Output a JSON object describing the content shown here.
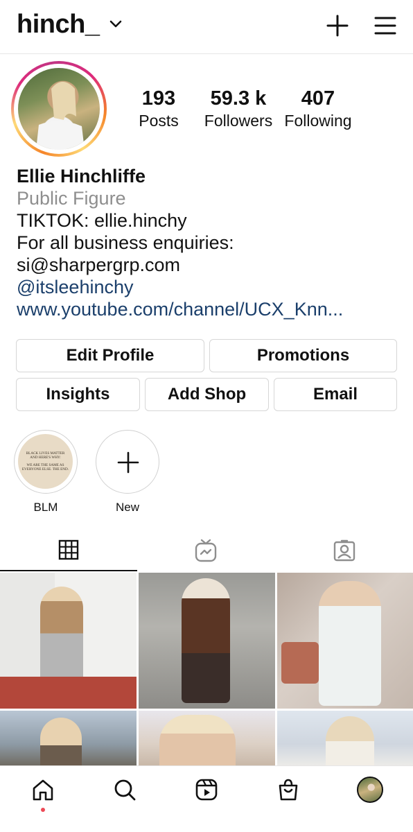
{
  "header": {
    "username": "hinch_"
  },
  "stats": {
    "posts_count": "193",
    "posts_label": "Posts",
    "followers_count": "59.3 k",
    "followers_label": "Followers",
    "following_count": "407",
    "following_label": "Following"
  },
  "bio": {
    "name": "Ellie Hinchliffe",
    "category": "Public Figure",
    "lines": [
      "TIKTOK: ellie.hinchy",
      "For all business enquiries:",
      "si@sharpergrp.com"
    ],
    "mention": "@itsleehinchy",
    "link": "www.youtube.com/channel/UCX_Knn..."
  },
  "buttons": {
    "edit_profile": "Edit Profile",
    "promotions": "Promotions",
    "insights": "Insights",
    "add_shop": "Add Shop",
    "email": "Email"
  },
  "highlights": [
    {
      "label": "BLM",
      "cover_text": [
        "BLACK LIVES MATTER",
        "AND HERE'S WHY:",
        "WE ARE THE SAME AS",
        "EVERYONE ELSE. THE END."
      ]
    },
    {
      "label": "New"
    }
  ],
  "tabs": [
    {
      "icon": "grid-icon",
      "active": true
    },
    {
      "icon": "igtv-icon",
      "active": false
    },
    {
      "icon": "tagged-icon",
      "active": false
    }
  ],
  "bottom_nav": [
    {
      "icon": "home-icon",
      "active": true
    },
    {
      "icon": "search-icon",
      "active": false
    },
    {
      "icon": "reels-icon",
      "active": false
    },
    {
      "icon": "shop-icon",
      "active": false
    },
    {
      "icon": "profile-avatar",
      "active": false
    }
  ],
  "colors": {
    "link": "#1b3f6b",
    "muted": "#8e8e8e",
    "notification_dot": "#ed4956"
  }
}
